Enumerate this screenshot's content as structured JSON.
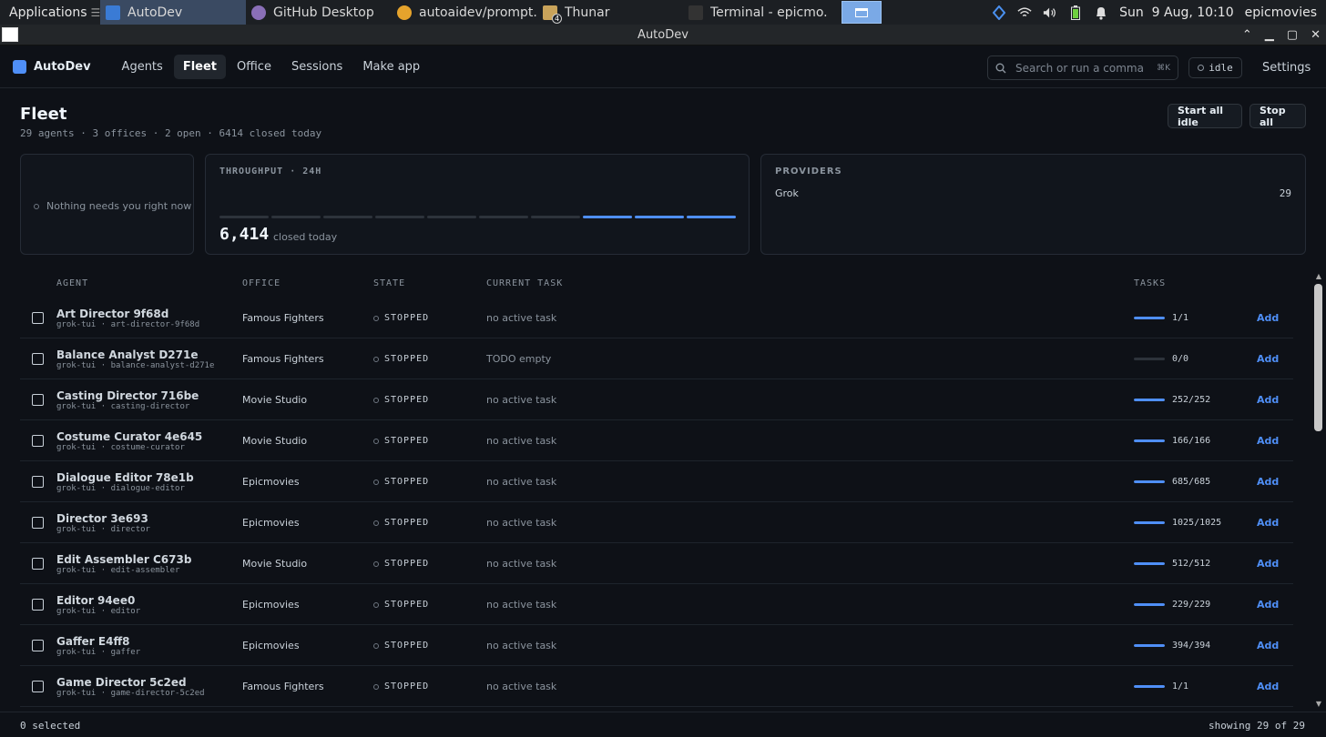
{
  "os": {
    "apps_label": "Applications",
    "tasks": [
      {
        "label": "AutoDev",
        "active": true,
        "icon": "window-icon",
        "color": "#3a7bd5"
      },
      {
        "label": "GitHub Desktop",
        "active": false,
        "icon": "github-icon",
        "color": "#8a6fb7"
      },
      {
        "label": "autoaidev/prompt...",
        "active": false,
        "icon": "chrome-icon",
        "color": "#e6a32c"
      },
      {
        "label": "Thunar",
        "active": false,
        "icon": "folder-icon",
        "color": "#c9a35a"
      },
      {
        "label": "Terminal - epicmo...",
        "active": false,
        "icon": "terminal-icon",
        "color": "#333333"
      }
    ],
    "folder_badge": "4",
    "clock": "Sun  9 Aug, 10:10",
    "user": "epicmovies"
  },
  "window": {
    "title": "AutoDev"
  },
  "header": {
    "brand": "AutoDev",
    "nav": [
      "Agents",
      "Fleet",
      "Office",
      "Sessions",
      "Make app"
    ],
    "active_nav": "Fleet",
    "search_placeholder": "Search or run a command",
    "search_shortcut": "⌘K",
    "status_pill": "idle",
    "settings": "Settings"
  },
  "page": {
    "title": "Fleet",
    "subtitle": "29 agents · 3 offices · 2 open · 6414 closed today",
    "start_all": "Start all idle",
    "stop_all": "Stop all"
  },
  "cards": {
    "attention": "Nothing needs you right now",
    "throughput": {
      "label": "THROUGHPUT · 24H",
      "value": "6,414",
      "caption": "closed today",
      "buckets_active": [
        false,
        false,
        false,
        false,
        false,
        false,
        false,
        true,
        true,
        true
      ]
    },
    "providers": {
      "label": "PROVIDERS",
      "items": [
        {
          "name": "Grok",
          "count": "29"
        }
      ]
    }
  },
  "table": {
    "headers": {
      "agent": "AGENT",
      "office": "OFFICE",
      "state": "STATE",
      "task": "CURRENT TASK",
      "tasks": "TASKS"
    },
    "add_label": "Add",
    "rows": [
      {
        "name": "Art Director 9f68d",
        "sub": "grok-tui · art-director-9f68d",
        "office": "Famous Fighters",
        "state": "STOPPED",
        "task": "no active task",
        "tasks": "1/1",
        "progress": 1.0
      },
      {
        "name": "Balance Analyst D271e",
        "sub": "grok-tui · balance-analyst-d271e",
        "office": "Famous Fighters",
        "state": "STOPPED",
        "task": "TODO empty",
        "tasks": "0/0",
        "progress": 0.0
      },
      {
        "name": "Casting Director 716be",
        "sub": "grok-tui · casting-director",
        "office": "Movie Studio",
        "state": "STOPPED",
        "task": "no active task",
        "tasks": "252/252",
        "progress": 1.0
      },
      {
        "name": "Costume Curator 4e645",
        "sub": "grok-tui · costume-curator",
        "office": "Movie Studio",
        "state": "STOPPED",
        "task": "no active task",
        "tasks": "166/166",
        "progress": 1.0
      },
      {
        "name": "Dialogue Editor 78e1b",
        "sub": "grok-tui · dialogue-editor",
        "office": "Epicmovies",
        "state": "STOPPED",
        "task": "no active task",
        "tasks": "685/685",
        "progress": 1.0
      },
      {
        "name": "Director 3e693",
        "sub": "grok-tui · director",
        "office": "Epicmovies",
        "state": "STOPPED",
        "task": "no active task",
        "tasks": "1025/1025",
        "progress": 1.0
      },
      {
        "name": "Edit Assembler C673b",
        "sub": "grok-tui · edit-assembler",
        "office": "Movie Studio",
        "state": "STOPPED",
        "task": "no active task",
        "tasks": "512/512",
        "progress": 1.0
      },
      {
        "name": "Editor 94ee0",
        "sub": "grok-tui · editor",
        "office": "Epicmovies",
        "state": "STOPPED",
        "task": "no active task",
        "tasks": "229/229",
        "progress": 1.0
      },
      {
        "name": "Gaffer E4ff8",
        "sub": "grok-tui · gaffer",
        "office": "Epicmovies",
        "state": "STOPPED",
        "task": "no active task",
        "tasks": "394/394",
        "progress": 1.0
      },
      {
        "name": "Game Director 5c2ed",
        "sub": "grok-tui · game-director-5c2ed",
        "office": "Famous Fighters",
        "state": "STOPPED",
        "task": "no active task",
        "tasks": "1/1",
        "progress": 1.0
      }
    ]
  },
  "footer": {
    "selected": "0 selected",
    "showing": "showing 29 of 29"
  }
}
